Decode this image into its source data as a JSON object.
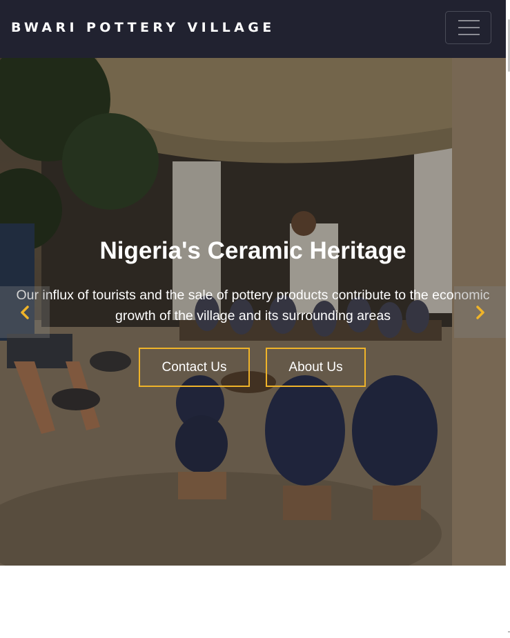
{
  "navbar": {
    "brand": "BWARI POTTERY VILLAGE",
    "toggler_icon": "hamburger-menu-icon"
  },
  "hero": {
    "title": "Nigeria's Ceramic Heritage",
    "text": "Our influx of tourists and the sale of pottery products contribute to the economic growth of the village and its surrounding areas",
    "buttons": {
      "contact": "Contact Us",
      "about": "About Us"
    },
    "controls": {
      "prev_icon": "chevron-left-icon",
      "next_icon": "chevron-right-icon"
    }
  },
  "colors": {
    "navbar_bg": "#212230",
    "accent": "#f0b429",
    "text": "#ffffff"
  }
}
